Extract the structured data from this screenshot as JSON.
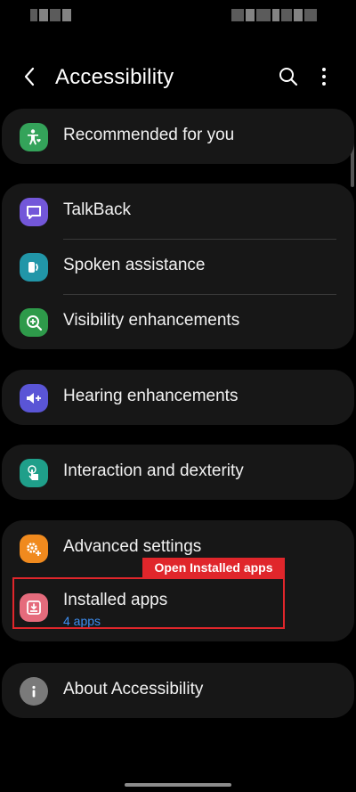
{
  "header": {
    "title": "Accessibility"
  },
  "items": [
    {
      "label": "Recommended for you",
      "icon": "person-heart-icon",
      "color": "#34a35a"
    },
    {
      "label": "TalkBack",
      "icon": "talkback-icon",
      "color": "#7357d9"
    },
    {
      "label": "Spoken assistance",
      "icon": "spoken-assistance-icon",
      "color": "#2196a8"
    },
    {
      "label": "Visibility enhancements",
      "icon": "magnifier-plus-icon",
      "color": "#2e9a4a"
    },
    {
      "label": "Hearing enhancements",
      "icon": "speaker-plus-icon",
      "color": "#5a55d6"
    },
    {
      "label": "Interaction and dexterity",
      "icon": "hand-touch-icon",
      "color": "#1f9f8a"
    },
    {
      "label": "Advanced settings",
      "icon": "gears-plus-icon",
      "color": "#f08a1e"
    },
    {
      "label": "Installed apps",
      "sub": "4 apps",
      "icon": "download-box-icon",
      "color": "#e56b7c"
    },
    {
      "label": "About Accessibility",
      "icon": "info-icon",
      "color": "#7a7a7a"
    }
  ],
  "annotation": {
    "text": "Open Installed apps",
    "color": "#e0262b"
  }
}
